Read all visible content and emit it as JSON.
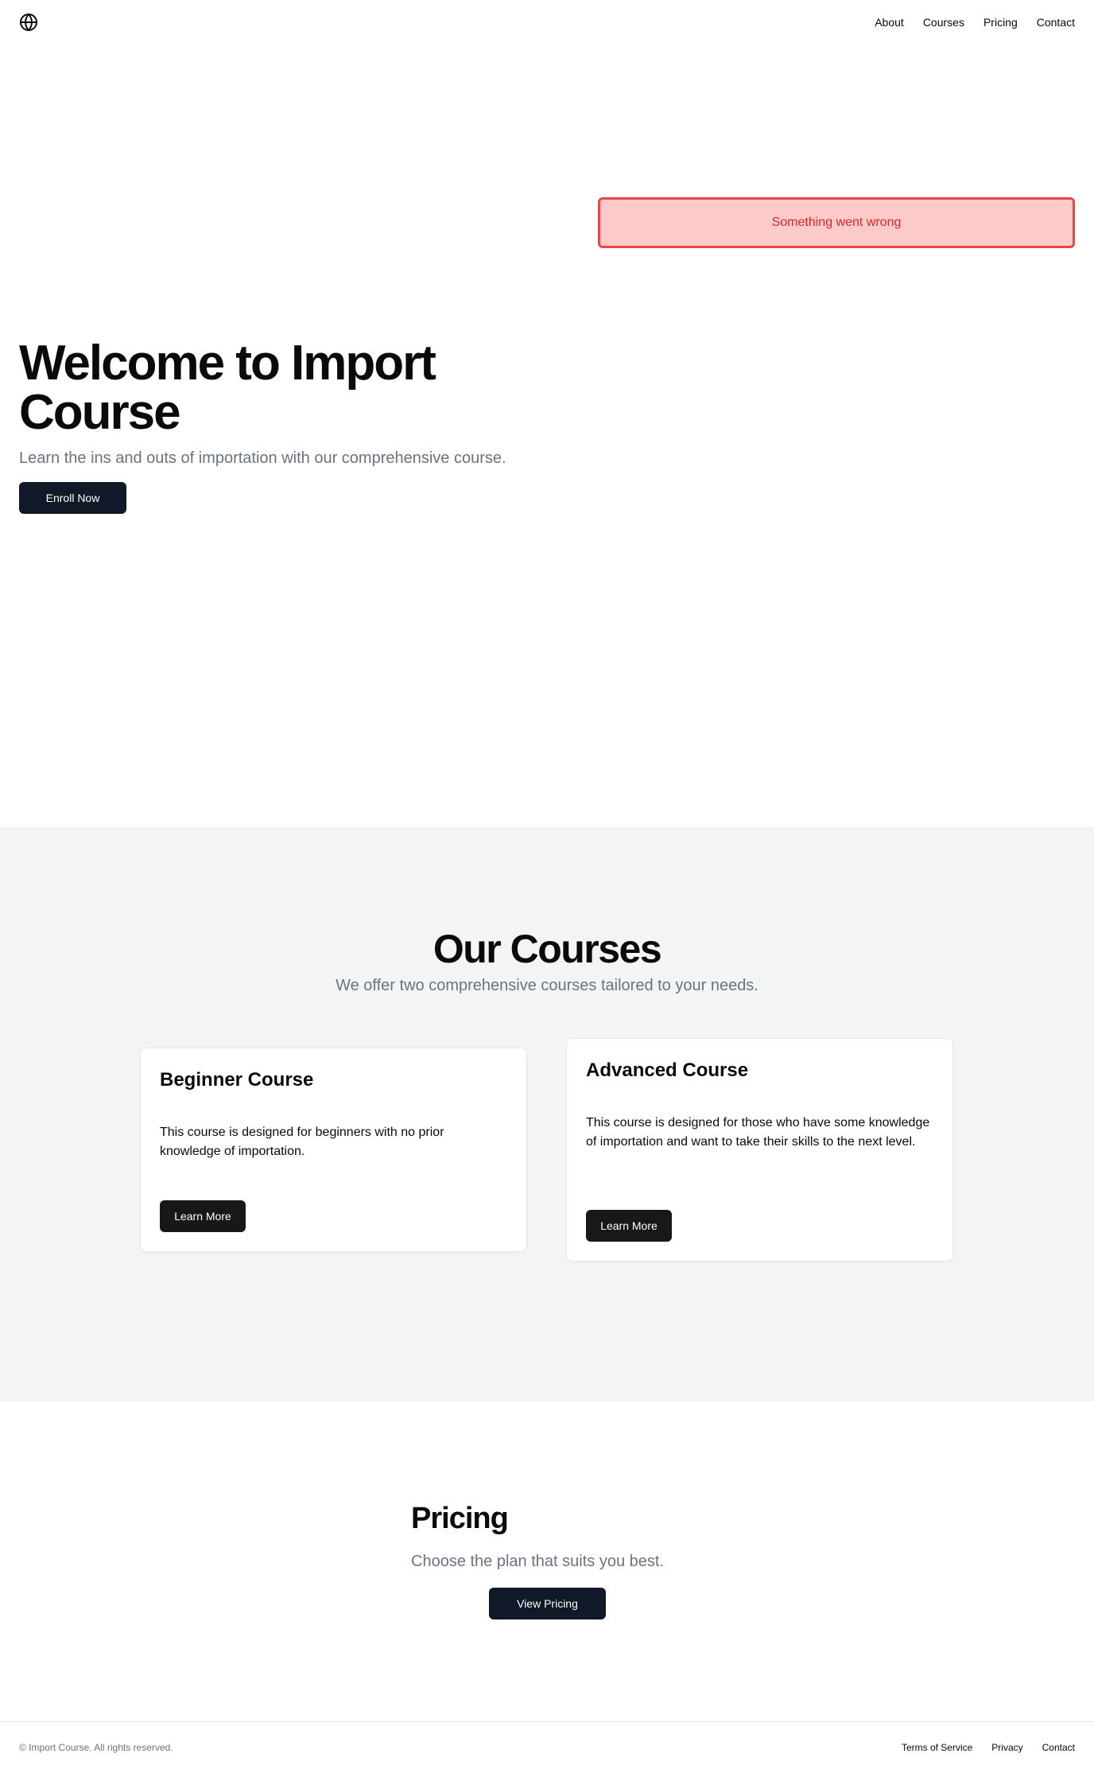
{
  "header": {
    "logo_icon": "globe-icon",
    "nav": [
      "About",
      "Courses",
      "Pricing",
      "Contact"
    ]
  },
  "hero": {
    "error_message": "Something went wrong",
    "title": "Welcome to Import Course",
    "subtitle": "Learn the ins and outs of importation with our comprehensive course.",
    "cta_label": "Enroll Now"
  },
  "courses": {
    "title": "Our Courses",
    "subtitle": "We offer two comprehensive courses tailored to your needs.",
    "items": [
      {
        "title": "Beginner Course",
        "description": "This course is designed for beginners with no prior knowledge of importation.",
        "button_label": "Learn More"
      },
      {
        "title": "Advanced Course",
        "description": "This course is designed for those who have some knowledge of importation and want to take their skills to the next level.",
        "button_label": "Learn More"
      }
    ]
  },
  "pricing": {
    "title": "Pricing",
    "subtitle": "Choose the plan that suits you best.",
    "button_label": "View Pricing"
  },
  "footer": {
    "copyright": "© Import Course. All rights reserved.",
    "links": [
      "Terms of Service",
      "Privacy",
      "Contact"
    ]
  },
  "colors": {
    "primary_button": "#111827",
    "error_bg": "#fecaca",
    "error_border": "#ef4444",
    "error_text": "#dc2626",
    "section_bg": "#f3f4f6",
    "muted_text": "#6b7280"
  }
}
